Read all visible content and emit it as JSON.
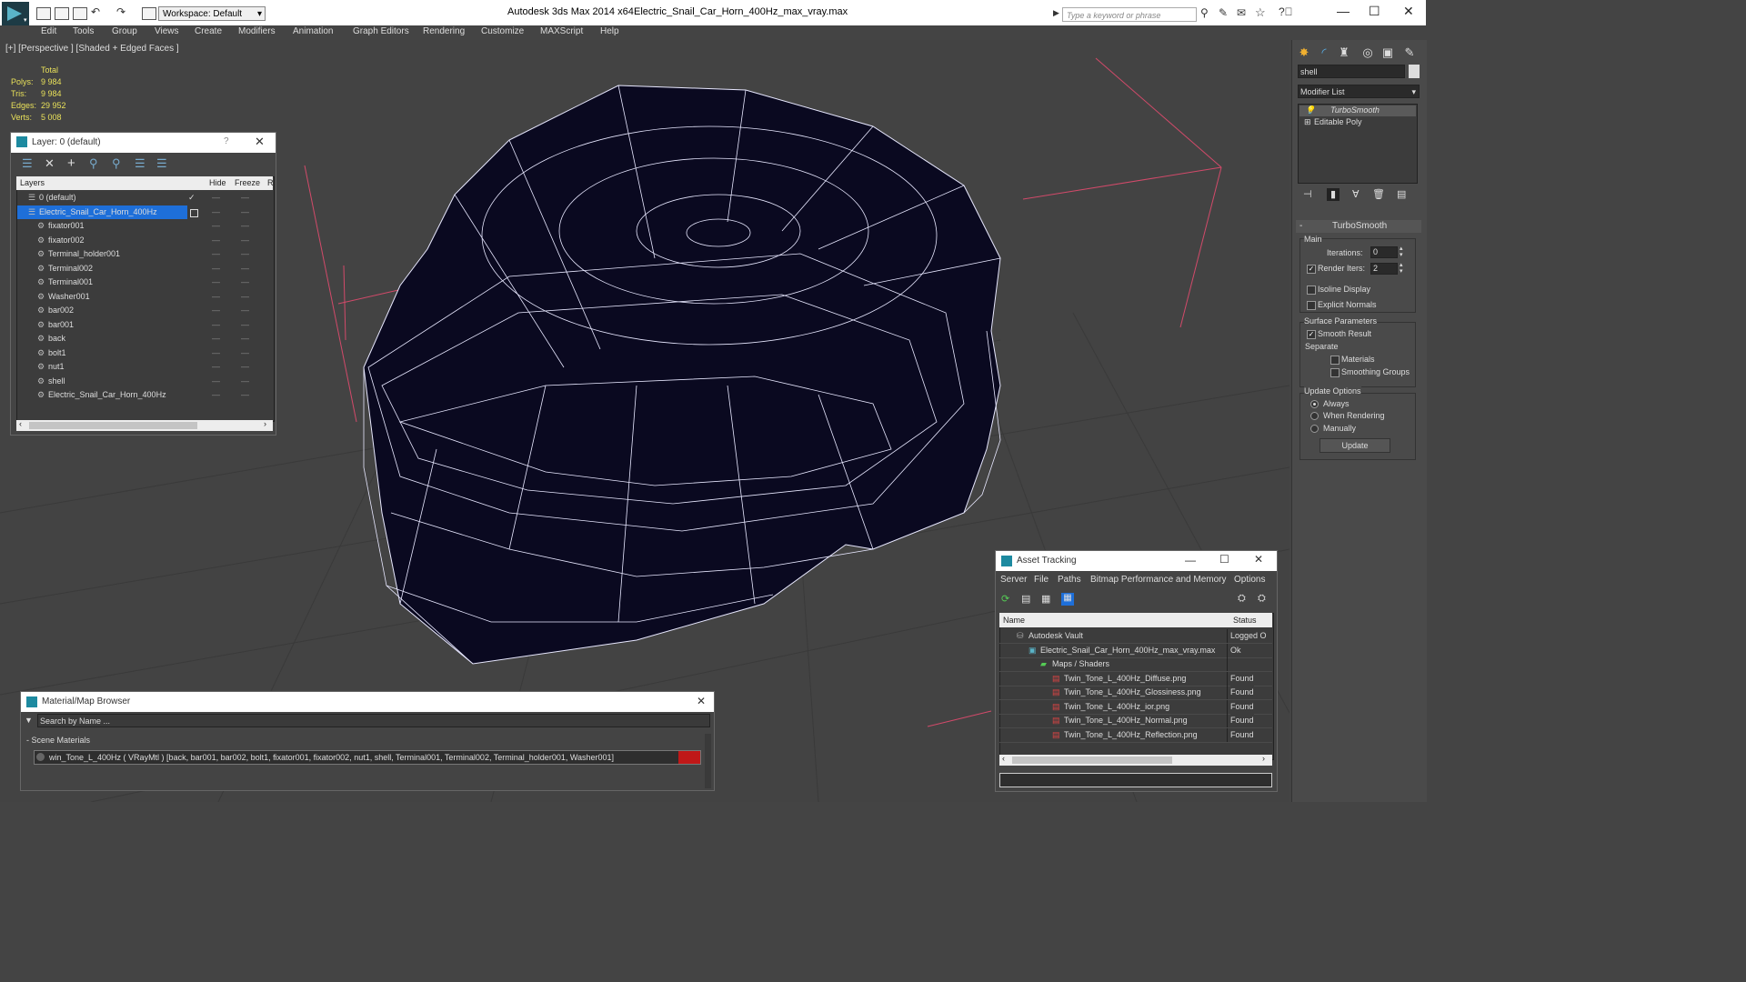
{
  "titlebar": {
    "workspace": "Workspace: Default",
    "app_title": "Autodesk 3ds Max  2014 x64",
    "doc_title": "Electric_Snail_Car_Horn_400Hz_max_vray.max",
    "search_placeholder": "Type a keyword or phrase"
  },
  "menu": [
    "Edit",
    "Tools",
    "Group",
    "Views",
    "Create",
    "Modifiers",
    "Animation",
    "Graph Editors",
    "Rendering",
    "Customize",
    "MAXScript",
    "Help"
  ],
  "viewport": {
    "label": "[+] [Perspective ] [Shaded + Edged Faces ]",
    "stats": {
      "header": "Total",
      "rows": [
        {
          "label": "Polys:",
          "value": "9 984"
        },
        {
          "label": "Tris:",
          "value": "9 984"
        },
        {
          "label": "Edges:",
          "value": "29 952"
        },
        {
          "label": "Verts:",
          "value": "5 008"
        }
      ]
    }
  },
  "cmdpanel": {
    "object_name": "shell",
    "modifier_list": "Modifier List",
    "stack": [
      "TurboSmooth",
      "Editable Poly"
    ],
    "rollout_title": "TurboSmooth",
    "main_label": "Main",
    "iterations_label": "Iterations:",
    "iterations_value": "0",
    "render_iters_label": "Render Iters:",
    "render_iters_value": "2",
    "isoline": "Isoline Display",
    "explicit": "Explicit Normals",
    "surface_params": "Surface Parameters",
    "smooth_result": "Smooth Result",
    "separate": "Separate",
    "materials": "Materials",
    "smoothing_groups": "Smoothing Groups",
    "update_options": "Update Options",
    "always": "Always",
    "when_rendering": "When Rendering",
    "manually": "Manually",
    "update_btn": "Update"
  },
  "layer_dialog": {
    "title": "Layer: 0 (default)",
    "help": "?",
    "col_layers": "Layers",
    "col_hide": "Hide",
    "col_freeze": "Freeze",
    "col_r": "R",
    "rows": [
      {
        "name": "0 (default)",
        "level": 0
      },
      {
        "name": "Electric_Snail_Car_Horn_400Hz",
        "level": 0,
        "selected": true
      },
      {
        "name": "fixator001",
        "level": 1
      },
      {
        "name": "fixator002",
        "level": 1
      },
      {
        "name": "Terminal_holder001",
        "level": 1
      },
      {
        "name": "Terminal002",
        "level": 1
      },
      {
        "name": "Terminal001",
        "level": 1
      },
      {
        "name": "Washer001",
        "level": 1
      },
      {
        "name": "bar002",
        "level": 1
      },
      {
        "name": "bar001",
        "level": 1
      },
      {
        "name": "back",
        "level": 1
      },
      {
        "name": "bolt1",
        "level": 1
      },
      {
        "name": "nut1",
        "level": 1
      },
      {
        "name": "shell",
        "level": 1
      },
      {
        "name": "Electric_Snail_Car_Horn_400Hz",
        "level": 1
      }
    ]
  },
  "material_browser": {
    "title": "Material/Map Browser",
    "search_placeholder": "Search by Name ...",
    "section": "- Scene Materials",
    "material": "win_Tone_L_400Hz  ( VRayMtl ) [back, bar001, bar002, bolt1, fixator001, fixator002, nut1, shell, Terminal001, Terminal002, Terminal_holder001, Washer001]"
  },
  "asset_tracking": {
    "title": "Asset Tracking",
    "menu": [
      "Server",
      "File",
      "Paths",
      "Bitmap Performance and Memory",
      "Options"
    ],
    "col_name": "Name",
    "col_status": "Status",
    "rows": [
      {
        "name": "Autodesk Vault",
        "status": "Logged O",
        "indent": 1
      },
      {
        "name": "Electric_Snail_Car_Horn_400Hz_max_vray.max",
        "status": "Ok",
        "indent": 2
      },
      {
        "name": "Maps / Shaders",
        "status": "",
        "indent": 3
      },
      {
        "name": "Twin_Tone_L_400Hz_Diffuse.png",
        "status": "Found",
        "indent": 4
      },
      {
        "name": "Twin_Tone_L_400Hz_Glossiness.png",
        "status": "Found",
        "indent": 4
      },
      {
        "name": "Twin_Tone_L_400Hz_ior.png",
        "status": "Found",
        "indent": 4
      },
      {
        "name": "Twin_Tone_L_400Hz_Normal.png",
        "status": "Found",
        "indent": 4
      },
      {
        "name": "Twin_Tone_L_400Hz_Reflection.png",
        "status": "Found",
        "indent": 4
      }
    ]
  },
  "colors": {
    "accent": "#1e6fd9",
    "model_fill": "#0a0920",
    "wire": "#e8e8ff",
    "gizmo": "#d24a6a"
  }
}
